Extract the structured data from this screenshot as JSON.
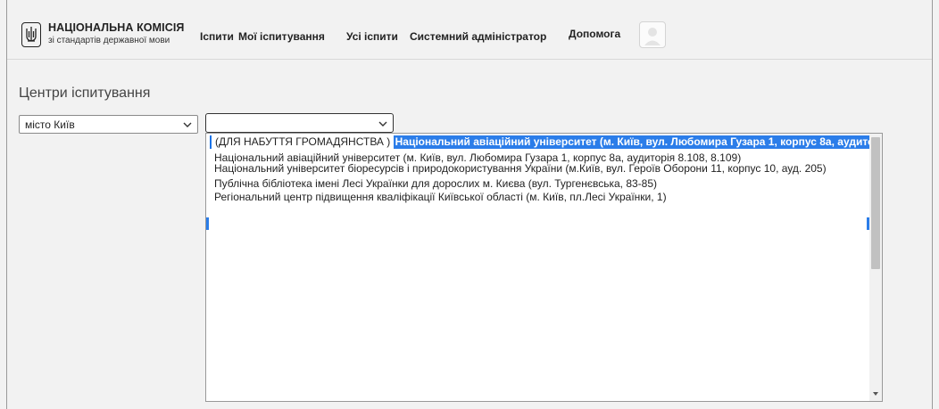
{
  "header": {
    "logo_title": "НАЦІОНАЛЬНА КОМІСІЯ",
    "logo_subtitle": "зі стандартів державної мови",
    "nav": [
      "Іспити",
      "Мої іспитування",
      "Усі іспити",
      "Системний адміністратор"
    ],
    "help": "Допомога"
  },
  "main": {
    "title": "Центри іспитування",
    "city_select_value": "місто Київ",
    "center_select_value": "",
    "dropdown": {
      "selected_prefix": "(ДЛЯ НАБУТТЯ ГРОМАДЯНСТВА )",
      "selected_label": "Національний авіаційний університет (м. Київ, вул. Любомира Гузара 1, корпус 8а, аудиторія 8.108, 8.109)",
      "options": [
        "Національний авіаційний університет (м. Київ, вул. Любомира Гузара 1, корпус 8а, аудиторія 8.108, 8.109)",
        "Національний університет біоресурсів і природокористування України (м.Київ, вул. Героїв Оборони 11, корпус 10, ауд. 205)",
        "Публічна бібліотека імені Лесі Українки для дорослих м. Києва (вул. Тургенєвська, 83-85)",
        "Регіональний центр підвищення кваліфікації Київської області (м. Київ, пл.Лесі Українки, 1)"
      ]
    }
  },
  "colors": {
    "highlight": "#2b7de9",
    "background": "#f2f2f2"
  }
}
